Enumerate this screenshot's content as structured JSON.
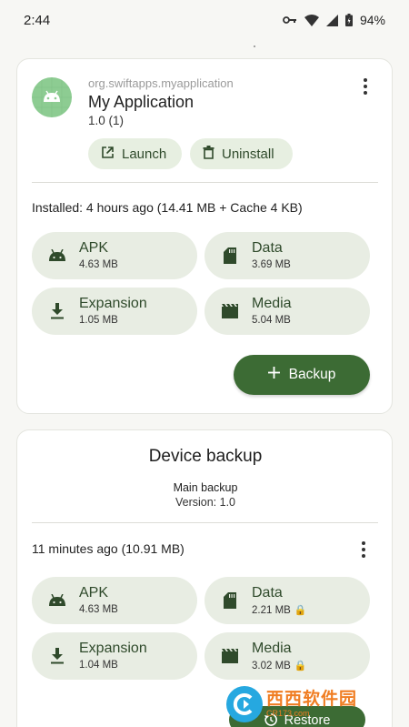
{
  "status_bar": {
    "time": "2:44",
    "battery": "94%"
  },
  "app": {
    "package": "org.swiftapps.myapplication",
    "name": "My Application",
    "version": "1.0 (1)",
    "launch_label": "Launch",
    "uninstall_label": "Uninstall",
    "installed_text": "Installed: 4 hours ago (14.41 MB + Cache 4 KB)",
    "tiles": [
      {
        "label": "APK",
        "size": "4.63 MB",
        "icon": "android-icon"
      },
      {
        "label": "Data",
        "size": "3.69 MB",
        "icon": "sd-card-icon"
      },
      {
        "label": "Expansion",
        "size": "1.05 MB",
        "icon": "download-icon"
      },
      {
        "label": "Media",
        "size": "5.04 MB",
        "icon": "movie-icon"
      }
    ],
    "backup_label": "Backup"
  },
  "device_backup": {
    "title": "Device backup",
    "subtitle": "Main backup",
    "version": "Version: 1.0",
    "time_text": "11 minutes ago (10.91 MB)",
    "tiles": [
      {
        "label": "APK",
        "size": "4.63 MB",
        "icon": "android-icon",
        "locked": false
      },
      {
        "label": "Data",
        "size": "2.21 MB",
        "icon": "sd-card-icon",
        "locked": true
      },
      {
        "label": "Expansion",
        "size": "1.04 MB",
        "icon": "download-icon",
        "locked": false
      },
      {
        "label": "Media",
        "size": "3.02 MB",
        "icon": "movie-icon",
        "locked": true
      }
    ],
    "restore_label": "Restore"
  },
  "watermark": {
    "brand": "西西软件园",
    "url": "CR173.com"
  },
  "colors": {
    "accent": "#3c6b34",
    "tile_bg": "#e8ede3",
    "chip_bg": "#e7efe1",
    "app_icon_bg": "#8dcc92"
  }
}
